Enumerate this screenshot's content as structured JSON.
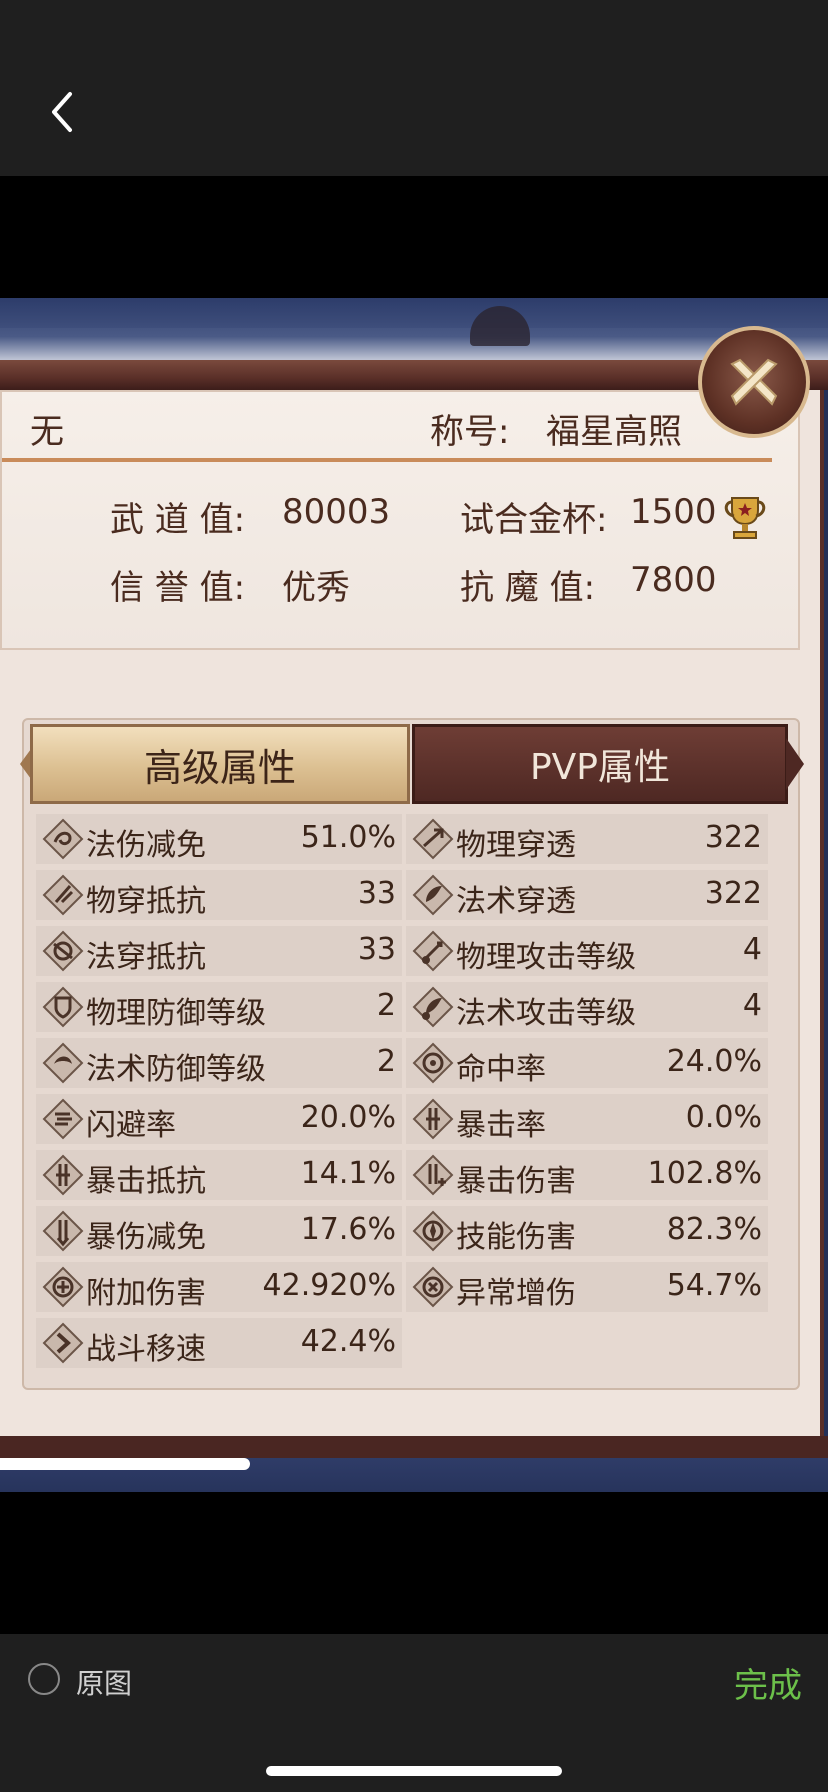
{
  "viewer": {
    "back_icon": "chevron-left-icon",
    "original_label": "原图",
    "done_label": "完成",
    "accent_color": "#6cc04a"
  },
  "game": {
    "close_icon": "crossed-swords-close-icon",
    "info": {
      "sect_value": "无",
      "title_label": "称号:",
      "title_value": "福星高照",
      "wudao_label": "武 道 值:",
      "wudao_value": "80003",
      "cup_label": "试合金杯:",
      "cup_value": "1500",
      "trophy_icon": "trophy-icon",
      "xinyu_label": "信 誉 值:",
      "xinyu_value": "优秀",
      "kangmo_label": "抗 魔 值:",
      "kangmo_value": "7800"
    },
    "tabs": [
      {
        "label": "高级属性",
        "active": true
      },
      {
        "label": "PVP属性",
        "active": false
      }
    ],
    "left_attrs": [
      {
        "label": "法伤减免",
        "value": "51.0%"
      },
      {
        "label": "物穿抵抗",
        "value": "33"
      },
      {
        "label": "法穿抵抗",
        "value": "33"
      },
      {
        "label": "物理防御等级",
        "value": "2"
      },
      {
        "label": "法术防御等级",
        "value": "2"
      },
      {
        "label": "闪避率",
        "value": "20.0%"
      },
      {
        "label": "暴击抵抗",
        "value": "14.1%"
      },
      {
        "label": "暴伤减免",
        "value": "17.6%"
      },
      {
        "label": "附加伤害",
        "value": "42.920%"
      },
      {
        "label": "战斗移速",
        "value": "42.4%"
      }
    ],
    "right_attrs": [
      {
        "label": "物理穿透",
        "value": "322"
      },
      {
        "label": "法术穿透",
        "value": "322"
      },
      {
        "label": "物理攻击等级",
        "value": "4"
      },
      {
        "label": "法术攻击等级",
        "value": "4"
      },
      {
        "label": "命中率",
        "value": "24.0%"
      },
      {
        "label": "暴击率",
        "value": "0.0%"
      },
      {
        "label": "暴击伤害",
        "value": "102.8%"
      },
      {
        "label": "技能伤害",
        "value": "82.3%"
      },
      {
        "label": "异常增伤",
        "value": "54.7%"
      }
    ]
  }
}
